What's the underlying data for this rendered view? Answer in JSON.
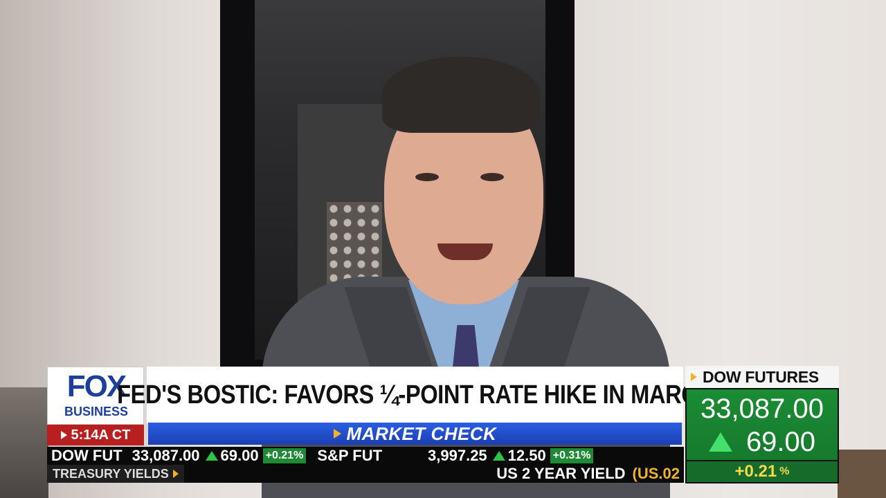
{
  "brand": {
    "logo_top": "FOX",
    "logo_bottom": "BUSINESS"
  },
  "clock": {
    "time": "5:14A CT"
  },
  "headline": {
    "text": "FED'S BOSTIC: FAVORS ¼-POINT RATE HIKE IN MARCH"
  },
  "segment": {
    "label": "MARKET CHECK"
  },
  "ticker": {
    "items": [
      {
        "name": "DOW FUT",
        "value": "33,087.00",
        "change": "69.00",
        "pct": "+0.21%"
      },
      {
        "name": "S&P FUT",
        "value": "3,997.25",
        "change": "12.50",
        "pct": "+0.31%"
      }
    ]
  },
  "ticker2": {
    "label": "TREASURY YIELDS",
    "yield_name": "US 2 YEAR YIELD",
    "yield_code": "(US.02"
  },
  "dow_box": {
    "title": "DOW FUTURES",
    "price": "33,087.00",
    "change": "69.00",
    "pct": "+0.21",
    "pct_unit": "%"
  },
  "colors": {
    "fox_blue": "#1c3f9c",
    "alert_red": "#b8201f",
    "market_blue": "#2b5fe3",
    "up_green": "#1c8c35",
    "accent_gold": "#f0b429"
  }
}
